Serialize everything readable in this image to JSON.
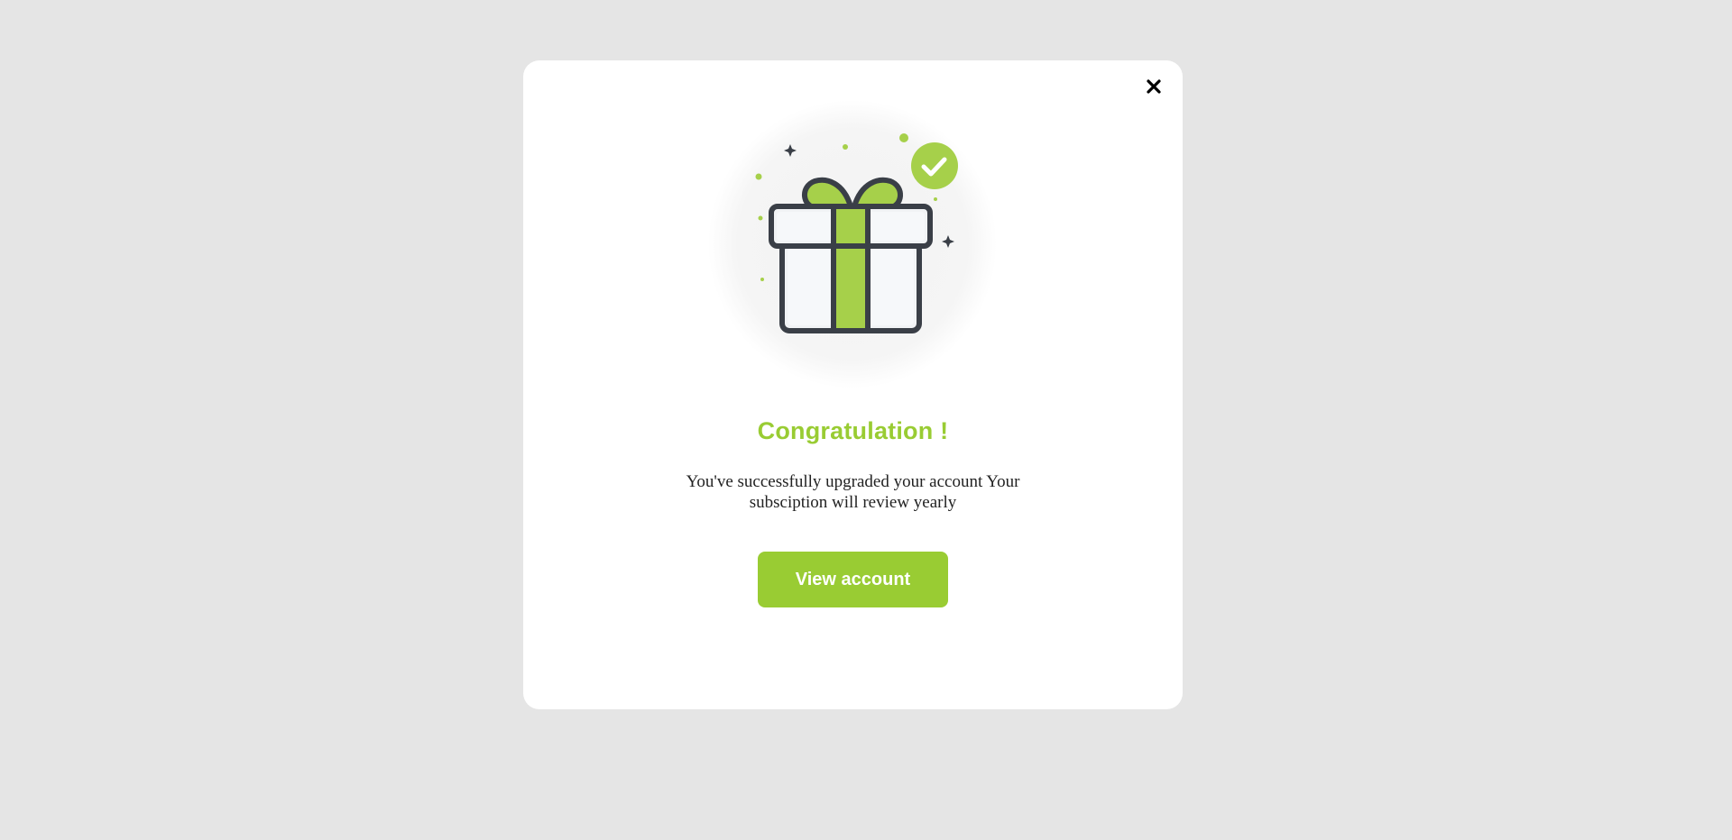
{
  "modal": {
    "close_icon": "close-icon",
    "illustration_icon": "gift-with-check-icon",
    "title": "Congratulation !",
    "message": "You've successfully upgraded your account Your subsciption will review yearly",
    "button_label": "View account"
  },
  "colors": {
    "accent": "#99cc33",
    "backdrop": "#e5e5e5",
    "card": "#ffffff",
    "outline": "#3a3f47"
  }
}
